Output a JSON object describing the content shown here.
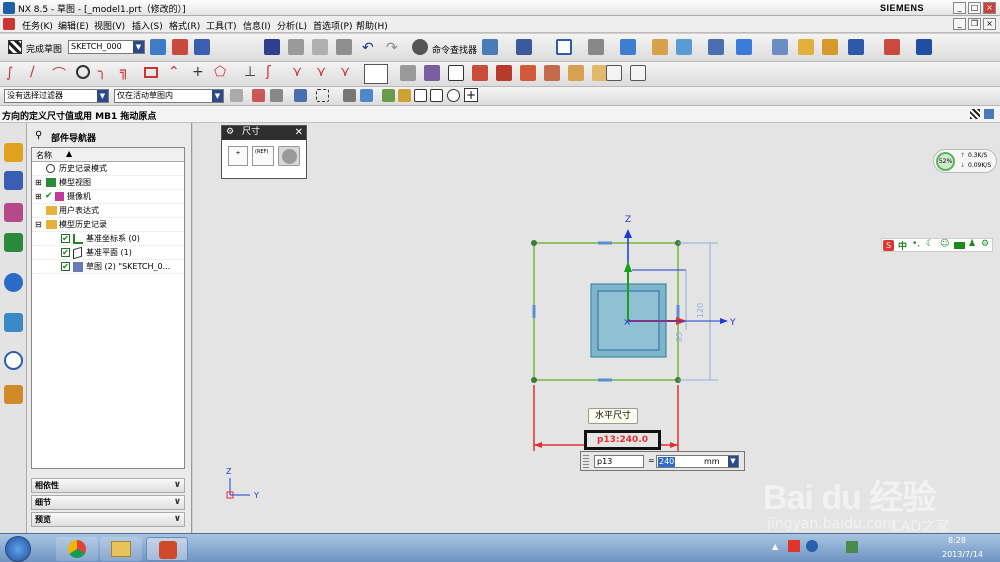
{
  "window": {
    "title": "NX 8.5 - 草图 - [_model1.prt（修改的）]",
    "brand": "SIEMENS"
  },
  "menu": [
    "任务(K)",
    "编辑(E)",
    "视图(V)",
    "插入(S)",
    "格式(R)",
    "工具(T)",
    "信息(I)",
    "分析(L)",
    "首选项(P)",
    "帮助(H)"
  ],
  "toolbar1": {
    "finish_label": "完成草图",
    "sketch_name": "SKETCH_000",
    "cmd_finder": "命令查找器"
  },
  "toolbar3": {
    "filter_label": "没有选择过滤器",
    "scope_label": "仅在活动草图内"
  },
  "cue_line": "方向的定义尺寸值或用 MB1 拖动原点",
  "navigator": {
    "title": "部件导航器",
    "col_name": "名称",
    "rows": [
      {
        "label": "历史记录模式"
      },
      {
        "label": "模型视图"
      },
      {
        "label": "摄像机"
      },
      {
        "label": "用户表达式"
      },
      {
        "label": "模型历史记录"
      },
      {
        "label": "基准坐标系 (0)"
      },
      {
        "label": "基准平面 (1)"
      },
      {
        "label": "草图 (2) \"SKETCH_0..."
      }
    ],
    "sections": [
      "相依性",
      "细节",
      "预览"
    ]
  },
  "dim_dialog": {
    "title": "尺寸",
    "ref_label": "(REF)"
  },
  "canvas": {
    "tooltip": "水平尺寸",
    "dim_label": "p13:240.0",
    "dim_input_name": "p13",
    "dim_input_value": "240",
    "unit": "mm",
    "eq": "=",
    "axis_z": "Z",
    "axis_y": "Y",
    "vert_dim": "120",
    "inner_dim": "85",
    "perf": {
      "percent": "52%",
      "up": "0.3K/S",
      "down": "0.09K/S"
    },
    "ime_label": "中"
  },
  "watermark": {
    "brand": "Bai du 经验",
    "url": "jingyan.baidu.com",
    "cad": "CAD之家"
  },
  "taskbar": {
    "date": "2013/7/14",
    "time": "8:28"
  },
  "colors": {
    "sketch_green": "#74b83a",
    "dim_red": "#e03030",
    "axis_blue": "#1a3bd6",
    "axis_green": "#18a018",
    "sketch_fill": "#7fb5c9"
  }
}
